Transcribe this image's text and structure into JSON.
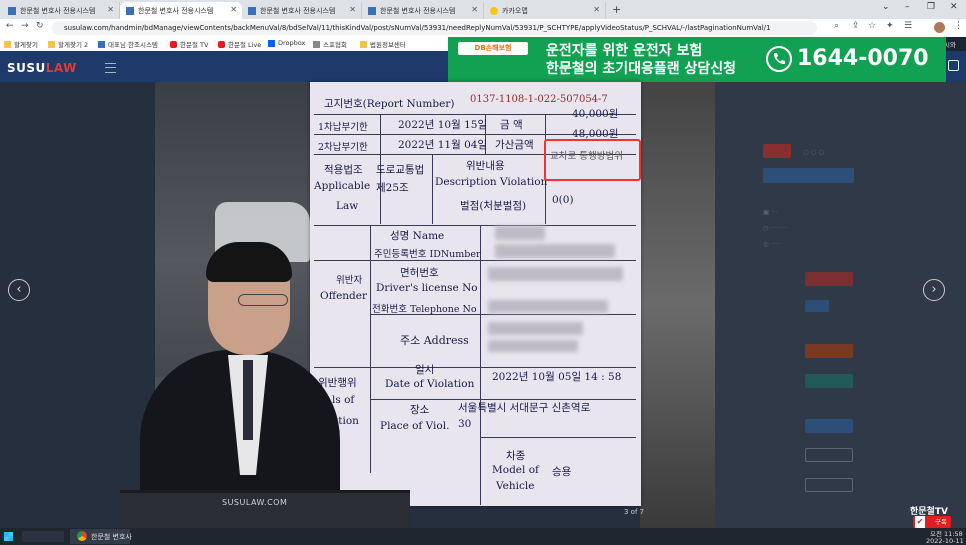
{
  "browser": {
    "tabs": [
      {
        "title": "한문철 변호사 전용시스템",
        "active": false
      },
      {
        "title": "한문철 변호사 전용시스템",
        "active": true
      },
      {
        "title": "한문철 변호사 전용시스템",
        "active": false
      },
      {
        "title": "한문철 변호사 전용시스템",
        "active": false
      },
      {
        "title": "카카오맵",
        "active": false
      }
    ],
    "url": "susulaw.com/handmin/bdManage/viewContents/backMenuVal/8/bdSelVal/11/thisKindVal/post/sNumVal/53931/needReplyNumVal/53931/P_SCHTYPE/applyVideoStatus/P_SCHVAL/-/lastPaginationNumVal/1",
    "bookmarks": [
      "할게찾기",
      "할게찾기 2",
      "대표님 한조시스템",
      "한문철 TV",
      "한문철 Live",
      "Dropbox",
      "스포협회",
      "법원정보센터"
    ],
    "bookmarks_right": "시와"
  },
  "site": {
    "logo_main": "SUSU",
    "logo_accent": "LAW"
  },
  "ad": {
    "brand": "DB손해보험",
    "line1": "운전자를 위한 운전자 보험",
    "line2": "한문철의 초기대응플랜 상담신청",
    "phone": "1644-0070",
    "brand_color": "#12a052"
  },
  "ticket": {
    "report_no_label": "고지번호(Report Number)",
    "report_no": "0137-1108-1-022-507054-7",
    "row1_label": "1차납부기한",
    "row1_date": "2022년 10월 15일",
    "row1_amount_label": "금 액",
    "row1_amount": "40,000원",
    "row2_label": "2차납부기한",
    "row2_date": "2022년 11월 04일",
    "row2_amount_label": "가산금액",
    "row2_amount": "48,000원",
    "law_label": "적용법조",
    "law_label_en1": "Applicable",
    "law_label_en2": "Law",
    "law_name": "도로교통법",
    "law_article": "제25조",
    "violation_label": "위반내용",
    "violation_label_en": "Description Violation",
    "violation_text": "교차로 통행방법위",
    "points_label": "벌점(처분벌점)",
    "points_value": "0(0)",
    "name_label": "성명 Name",
    "id_label": "주민등록번호 IDNumber",
    "license_label": "면허번호",
    "license_label_en": "Driver's license No",
    "phone_label": "전화번호 Telephone No",
    "offender_label": "위반자",
    "offender_label_en": "Offender",
    "address_label": "주소 Address",
    "date_label": "일시",
    "date_label_en": "Date of Violation",
    "date_value": "2022년 10월 05일   14 : 58",
    "violation_act_label": "위반행위",
    "violation_act_en1": "ls of",
    "violation_act_en2": "ation",
    "place_label": "장소",
    "place_label_en": "Place of Viol.",
    "place_value": "서울특별시 서대문구 신촌역로",
    "place_value2": "30",
    "vehicle_label": "차종",
    "vehicle_label_en1": "Model of",
    "vehicle_label_en2": "Vehicle",
    "vehicle_value": "승용"
  },
  "viewer": {
    "page_indicator": "3 of 7",
    "prev_glyph": "‹",
    "next_glyph": "›"
  },
  "overlay": {
    "monitor_text": "SUSULAW.COM",
    "channel": "한문철TV",
    "subscribe": "구독",
    "subscribe_check": "✔"
  },
  "taskbar": {
    "app": "한문철 변호사",
    "time": "오전 11:58",
    "date": "2022-10-11"
  }
}
